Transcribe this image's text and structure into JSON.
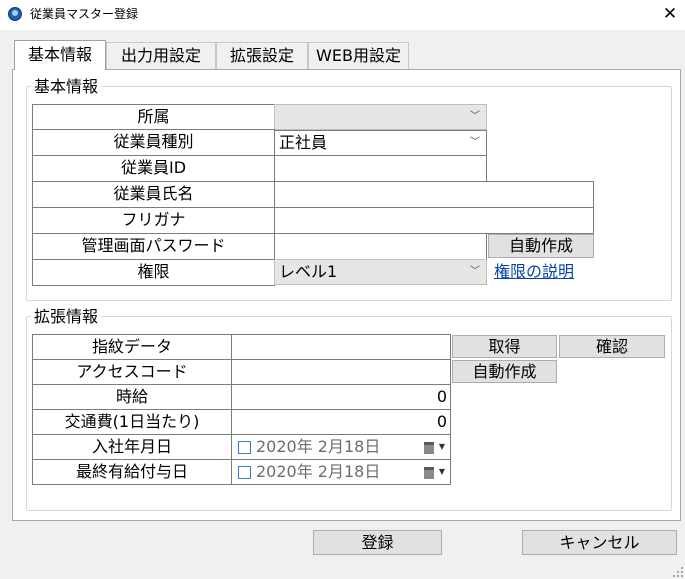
{
  "window": {
    "title": "従業員マスター登録",
    "close_glyph": "✕"
  },
  "tabs": [
    "基本情報",
    "出力用設定",
    "拡張設定",
    "WEB用設定"
  ],
  "basic": {
    "legend": "基本情報",
    "labels": {
      "affiliation": "所属",
      "employee_type": "従業員種別",
      "employee_id": "従業員ID",
      "employee_name": "従業員氏名",
      "furigana": "フリガナ",
      "password": "管理画面パスワード",
      "authority": "権限"
    },
    "values": {
      "affiliation": "",
      "employee_type": "正社員",
      "employee_id": "",
      "employee_name": "",
      "furigana": "",
      "password": "",
      "authority": "レベル1"
    },
    "auto_create": "自動作成",
    "authority_help": "権限の説明"
  },
  "ext": {
    "legend": "拡張情報",
    "labels": {
      "fingerprint": "指紋データ",
      "access_code": "アクセスコード",
      "hourly_wage": "時給",
      "transport": "交通費(1日当たり)",
      "hire_date": "入社年月日",
      "last_paid_leave": "最終有給付与日"
    },
    "values": {
      "fingerprint": "",
      "access_code": "",
      "hourly_wage": "0",
      "transport": "0",
      "hire_date": "2020年  2月18日",
      "last_paid_leave": "2020年  2月18日"
    },
    "get_button": "取得",
    "confirm_button": "確認",
    "auto_create": "自動作成"
  },
  "footer": {
    "register": "登録",
    "cancel": "キャンセル"
  },
  "icons": {
    "app": "app-icon",
    "close": "close-icon",
    "dropdown": "chevron-down-icon",
    "calendar": "calendar-icon"
  }
}
